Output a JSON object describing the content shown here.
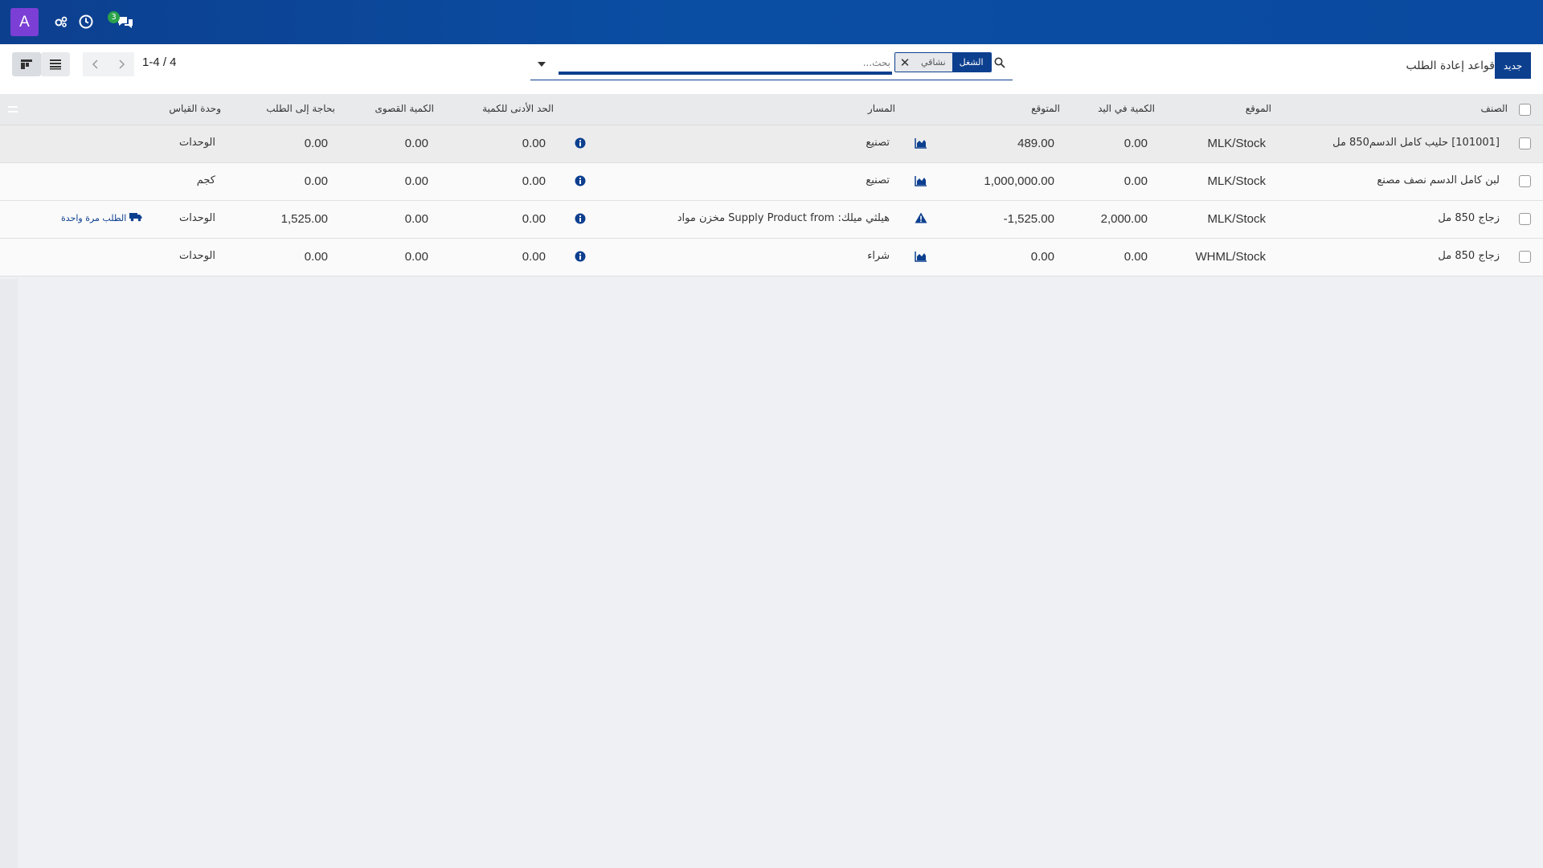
{
  "navbar": {
    "avatar_letter": "A",
    "icons": [
      "settings-icon",
      "clock-icon",
      "chat-icon"
    ],
    "chat_badge": "3"
  },
  "control": {
    "title": "قواعد إعادة الطلب",
    "new_button": "جديد",
    "pager": "1-4 / 4",
    "search_placeholder": "بحث...",
    "facet_label": "الشغل",
    "facet_value": "نشاقي"
  },
  "table": {
    "headers": {
      "product": "الصنف",
      "location": "الموقع",
      "on_hand": "الكمية في اليد",
      "forecast": "المتوقع",
      "route": "المسار",
      "min_qty": "الحد الأدنى للكمية",
      "max_qty": "الكمية القصوى",
      "to_order": "بحاجة إلى الطلب",
      "uom": "وحدة القياس"
    },
    "rows": [
      {
        "product": "[101001] حليب كامل الدسم850 مل",
        "location": "MLK/Stock",
        "on_hand": "0.00",
        "forecast": "489.00",
        "route": "تصنيع",
        "min_qty": "0.00",
        "max_qty": "0.00",
        "to_order": "0.00",
        "uom": "الوحدات",
        "forecast_icon": "chart-area-icon",
        "order_once": ""
      },
      {
        "product": "لبن كامل الدسم نصف مصنع",
        "location": "MLK/Stock",
        "on_hand": "0.00",
        "forecast": "1,000,000.00",
        "route": "تصنيع",
        "min_qty": "0.00",
        "max_qty": "0.00",
        "to_order": "0.00",
        "uom": "كجم",
        "forecast_icon": "chart-area-icon",
        "order_once": ""
      },
      {
        "product": "زجاج 850 مل",
        "location": "MLK/Stock",
        "on_hand": "2,000.00",
        "forecast": "-1,525.00",
        "route": "هيلثي ميلك: Supply Product from مخزن مواد",
        "min_qty": "0.00",
        "max_qty": "0.00",
        "to_order": "1,525.00",
        "uom": "الوحدات",
        "forecast_icon": "warning-icon",
        "order_once": "الطلب مرة واحدة"
      },
      {
        "product": "زجاج 850 مل",
        "location": "WHML/Stock",
        "on_hand": "0.00",
        "forecast": "0.00",
        "route": "شراء",
        "min_qty": "0.00",
        "max_qty": "0.00",
        "to_order": "0.00",
        "uom": "الوحدات",
        "forecast_icon": "chart-area-icon",
        "order_once": ""
      }
    ]
  },
  "colors": {
    "navbar": "#0d3f8f",
    "avatar": "#7b3fd6",
    "badge": "#2aa24a",
    "primary_button": "#0d3f8f"
  }
}
